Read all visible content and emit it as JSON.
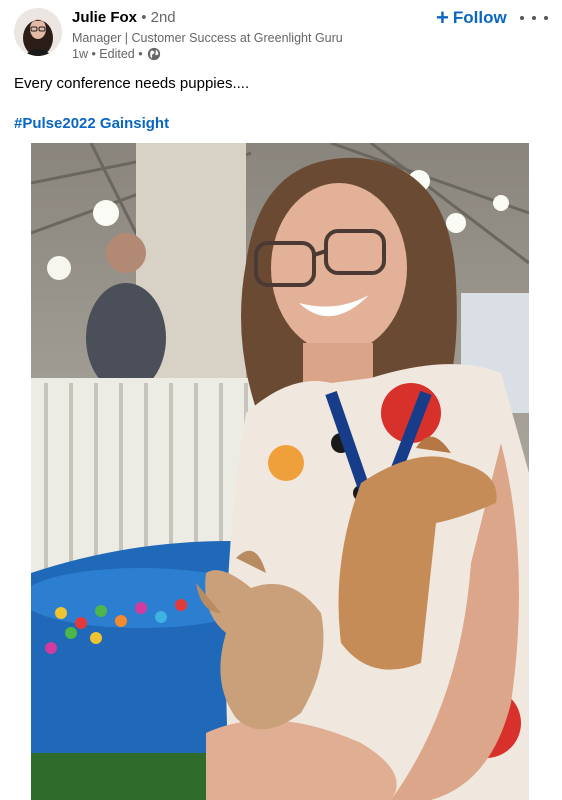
{
  "author": {
    "name": "Julie Fox",
    "degree": "• 2nd",
    "headline": "Manager | Customer Success at Greenlight Guru",
    "time": "1w • Edited •",
    "visibility_icon": "globe-icon"
  },
  "actions": {
    "follow_label": "Follow",
    "follow_color": "#0a66c2",
    "more_icon": "more-dots-icon"
  },
  "post": {
    "text": "Every conference needs puppies....",
    "hashtags": [
      "#Pulse2022",
      "Gainsight"
    ]
  }
}
